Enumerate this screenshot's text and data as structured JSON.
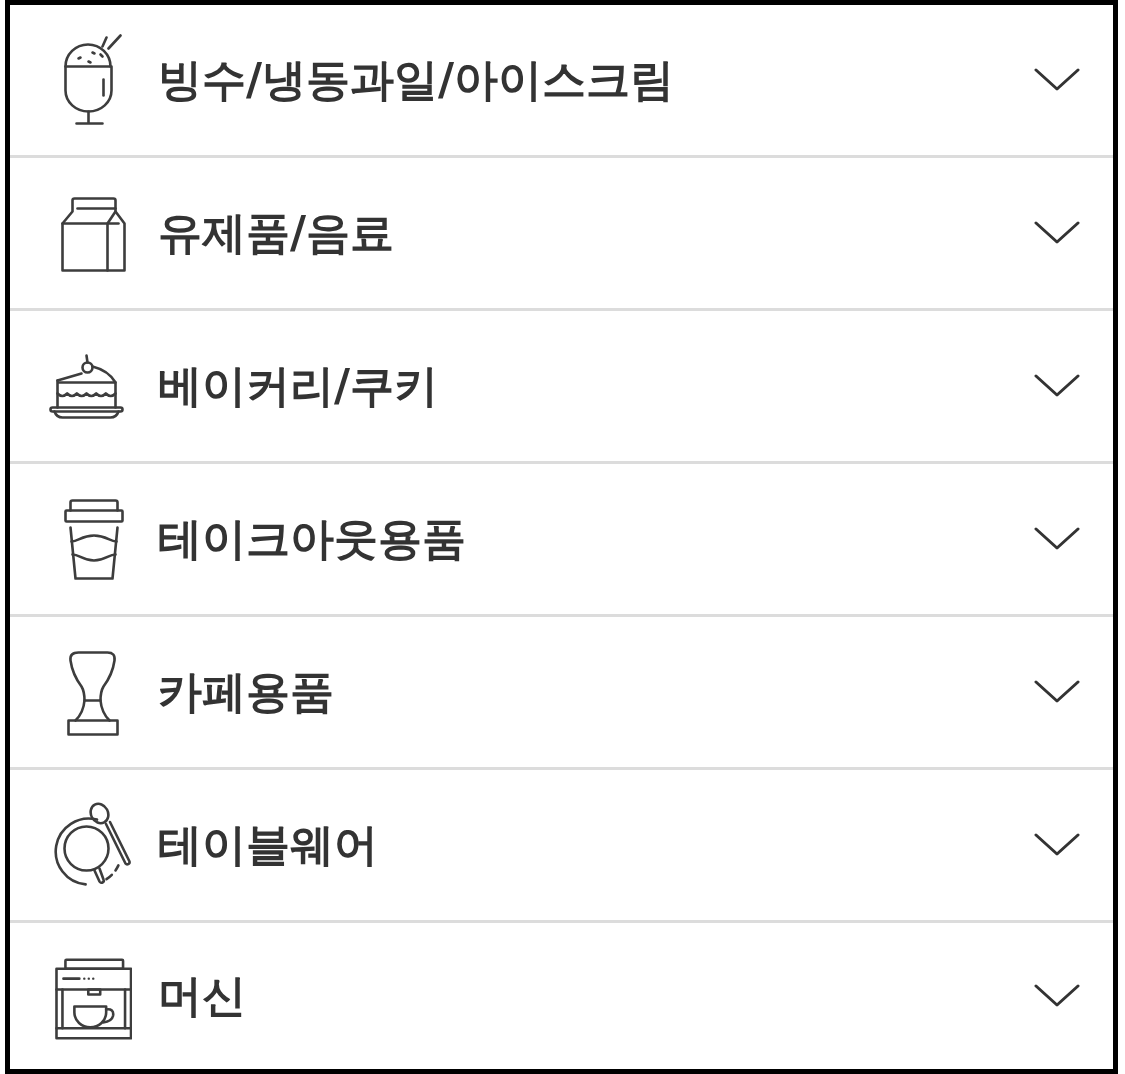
{
  "categories": [
    {
      "kind": "shaved-ice",
      "label": "빙수/냉동과일/아이스크림",
      "expanded": false
    },
    {
      "kind": "milk-carton",
      "label": "유제품/음료",
      "expanded": false
    },
    {
      "kind": "cake",
      "label": "베이커리/쿠키",
      "expanded": false
    },
    {
      "kind": "takeout-cup",
      "label": "테이크아웃용품",
      "expanded": false
    },
    {
      "kind": "tamper",
      "label": "카페용품",
      "expanded": false
    },
    {
      "kind": "tableware",
      "label": "테이블웨어",
      "expanded": false
    },
    {
      "kind": "coffee-machine",
      "label": "머신",
      "expanded": false
    }
  ]
}
